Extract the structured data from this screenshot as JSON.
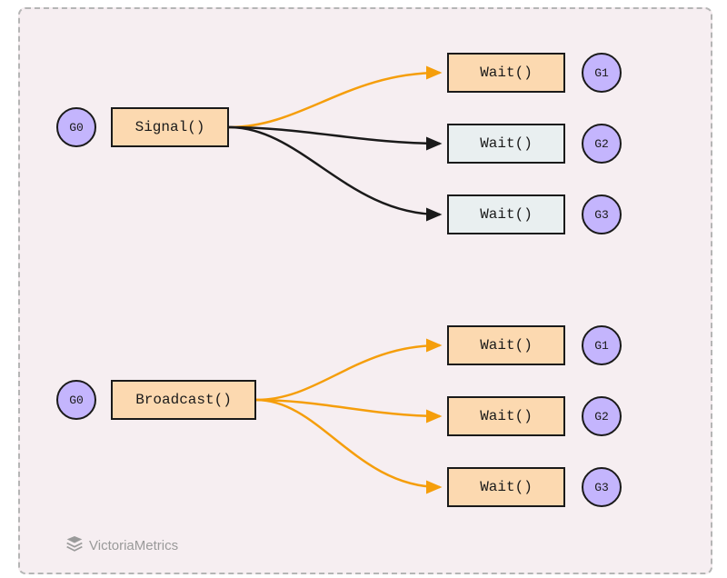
{
  "diagram": {
    "background": "#f6eef1",
    "signal": {
      "source_goroutine": "G0",
      "operation": "Signal()",
      "targets": [
        {
          "label": "Wait()",
          "goroutine": "G1",
          "highlighted": true
        },
        {
          "label": "Wait()",
          "goroutine": "G2",
          "highlighted": false
        },
        {
          "label": "Wait()",
          "goroutine": "G3",
          "highlighted": false
        }
      ]
    },
    "broadcast": {
      "source_goroutine": "G0",
      "operation": "Broadcast()",
      "targets": [
        {
          "label": "Wait()",
          "goroutine": "G1",
          "highlighted": true
        },
        {
          "label": "Wait()",
          "goroutine": "G2",
          "highlighted": true
        },
        {
          "label": "Wait()",
          "goroutine": "G3",
          "highlighted": true
        }
      ]
    }
  },
  "colors": {
    "arrow_highlight": "#f59e0b",
    "arrow_dim": "#1a1a1a",
    "goroutine_fill": "#c4b5fd",
    "box_highlight": "#fcd9b0",
    "box_dim": "#e9eff0"
  },
  "watermark": "VictoriaMetrics"
}
